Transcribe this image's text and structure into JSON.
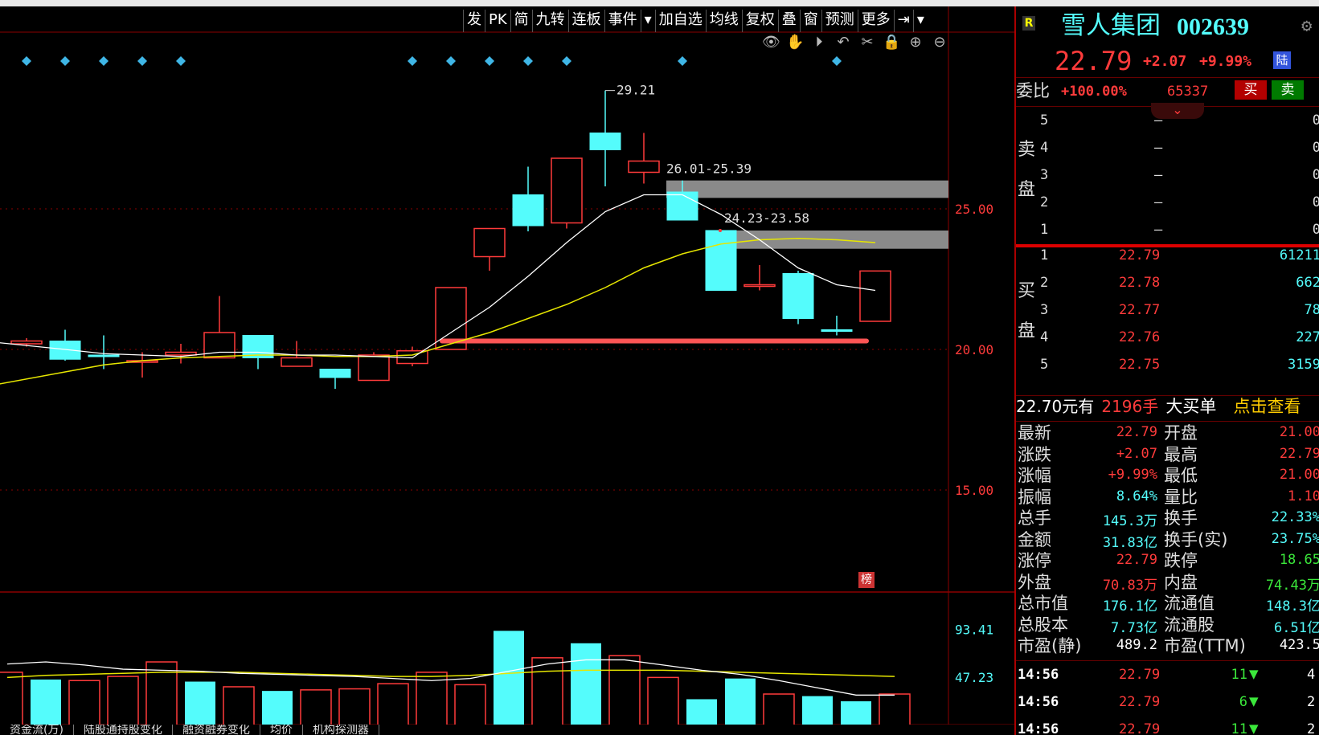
{
  "toolbar": {
    "items": [
      "发",
      "PK",
      "简",
      "九转",
      "连板",
      "事件",
      "▾",
      "加自选",
      "均线",
      "复权",
      "叠",
      "窗",
      "预测",
      "更多",
      "⇥",
      "▾"
    ],
    "tools": [
      "👁",
      "✋",
      "⏵",
      "↶",
      "✂",
      "🔒",
      "⊕",
      "⊖"
    ]
  },
  "chart_data": {
    "type": "candlestick",
    "price_axis": {
      "ticks": [
        "25.00",
        "20.00",
        "15.00"
      ],
      "tick_values": [
        25,
        20,
        15
      ],
      "ylim": [
        10.25,
        29.25
      ]
    },
    "volume_axis": {
      "ticks": [
        "93.41",
        "47.23"
      ],
      "tick_values": [
        93.41,
        47.23
      ],
      "ylim": [
        0,
        100
      ]
    },
    "candles": [
      {
        "o": 20.2,
        "h": 20.4,
        "l": 20.1,
        "c": 20.3,
        "up": true
      },
      {
        "o": 20.3,
        "h": 20.7,
        "l": 19.6,
        "c": 19.65,
        "up": false
      },
      {
        "o": 19.8,
        "h": 20.5,
        "l": 19.3,
        "c": 19.8,
        "up": false
      },
      {
        "o": 19.6,
        "h": 19.9,
        "l": 19.0,
        "c": 19.6,
        "up": true
      },
      {
        "o": 19.9,
        "h": 20.2,
        "l": 19.5,
        "c": 19.8,
        "up": true
      },
      {
        "o": 19.7,
        "h": 21.9,
        "l": 19.7,
        "c": 20.6,
        "up": true
      },
      {
        "o": 20.5,
        "h": 20.5,
        "l": 19.3,
        "c": 19.7,
        "up": false
      },
      {
        "o": 19.4,
        "h": 20.3,
        "l": 19.4,
        "c": 19.7,
        "up": true
      },
      {
        "o": 19.3,
        "h": 19.3,
        "l": 18.6,
        "c": 19.0,
        "up": false
      },
      {
        "o": 18.9,
        "h": 19.9,
        "l": 18.9,
        "c": 19.8,
        "up": true
      },
      {
        "o": 19.5,
        "h": 20.1,
        "l": 19.4,
        "c": 19.95,
        "up": true
      },
      {
        "o": 20.0,
        "h": 22.2,
        "l": 20.0,
        "c": 22.2,
        "up": true
      },
      {
        "o": 23.3,
        "h": 24.3,
        "l": 22.8,
        "c": 24.3,
        "up": true
      },
      {
        "o": 25.5,
        "h": 26.5,
        "l": 24.2,
        "c": 24.4,
        "up": false
      },
      {
        "o": 24.5,
        "h": 26.8,
        "l": 24.3,
        "c": 26.8,
        "up": true
      },
      {
        "o": 27.7,
        "h": 29.21,
        "l": 25.8,
        "c": 27.1,
        "up": false
      },
      {
        "o": 26.3,
        "h": 27.7,
        "l": 25.9,
        "c": 26.7,
        "up": true
      },
      {
        "o": 25.6,
        "h": 26.01,
        "l": 24.6,
        "c": 24.6,
        "up": false
      },
      {
        "o": 24.23,
        "h": 24.23,
        "l": 22.1,
        "c": 22.1,
        "up": false
      },
      {
        "o": 22.3,
        "h": 23.0,
        "l": 22.1,
        "c": 22.3,
        "up": true
      },
      {
        "o": 22.7,
        "h": 22.8,
        "l": 20.9,
        "c": 21.1,
        "up": false
      },
      {
        "o": 20.7,
        "h": 21.2,
        "l": 20.5,
        "c": 20.7,
        "up": false
      },
      {
        "o": 21.0,
        "h": 22.79,
        "l": 21.0,
        "c": 22.79,
        "up": true
      }
    ],
    "ma_white": [
      20.25,
      20.0,
      19.85,
      19.8,
      19.75,
      19.9,
      19.9,
      19.8,
      19.8,
      19.75,
      19.7,
      20.6,
      21.5,
      22.6,
      23.8,
      24.9,
      25.5,
      25.5,
      24.8,
      23.9,
      22.9,
      22.3,
      22.1
    ],
    "ma_yellow": [
      18.75,
      19.2,
      19.45,
      19.6,
      19.7,
      19.75,
      19.8,
      19.8,
      19.75,
      19.75,
      19.8,
      20.2,
      20.6,
      21.1,
      21.6,
      22.2,
      22.9,
      23.4,
      23.75,
      23.9,
      23.95,
      23.9,
      23.8
    ],
    "volumes": [
      [
        52,
        true
      ],
      [
        45,
        false
      ],
      [
        44,
        true
      ],
      [
        48,
        true
      ],
      [
        62,
        true
      ],
      [
        43,
        false
      ],
      [
        38,
        true
      ],
      [
        34,
        false
      ],
      [
        35,
        true
      ],
      [
        36,
        true
      ],
      [
        41,
        true
      ],
      [
        52,
        true
      ],
      [
        40,
        true
      ],
      [
        92,
        false
      ],
      [
        66,
        true
      ],
      [
        80,
        false
      ],
      [
        68,
        true
      ],
      [
        47,
        true
      ],
      [
        26,
        false
      ],
      [
        46,
        false
      ],
      [
        31,
        true
      ],
      [
        29,
        false
      ],
      [
        24,
        false
      ],
      [
        31,
        true
      ]
    ],
    "vol_ma_white": [
      60,
      62,
      59,
      55,
      54,
      53,
      51,
      50,
      49,
      48,
      46,
      44,
      46,
      53,
      60,
      64,
      64,
      59,
      54,
      50,
      44,
      37,
      30,
      30
    ],
    "vol_ma_yellow": [
      47,
      49,
      50,
      51,
      52,
      52,
      52,
      51,
      50,
      49,
      48,
      48,
      49,
      51,
      53,
      54,
      54,
      54,
      53,
      52,
      51,
      50,
      49,
      48
    ],
    "annotations": {
      "high_label": "29.21",
      "zone1_label": "26.01-25.39",
      "zone1": [
        26.01,
        25.39
      ],
      "zone2_label": "24.23-23.58",
      "zone2": [
        24.23,
        23.58
      ],
      "support_level": 20.3
    },
    "markers": [
      0,
      1,
      2,
      3,
      4,
      10,
      11,
      12,
      13,
      14,
      17,
      21
    ]
  },
  "rank_badge": "榜",
  "bottom_tabs": [
    "资金流(万)",
    "陆股通持股变化",
    "融资融券变化",
    "均价",
    "机构探测器"
  ],
  "stock": {
    "badge": "R",
    "name": "雪人集团",
    "code": "002639",
    "price": "22.79",
    "change": "+2.07",
    "change_pct": "+9.99%",
    "lu_badge": "陆"
  },
  "weibi": {
    "label": "委比",
    "value": "+100.00%",
    "count": "65337",
    "buy_btn": "买",
    "sell_btn": "卖"
  },
  "sell_side": {
    "label": "卖盘",
    "rows": [
      {
        "n": "5",
        "price": "—",
        "vol": "0"
      },
      {
        "n": "4",
        "price": "—",
        "vol": "0"
      },
      {
        "n": "3",
        "price": "—",
        "vol": "0"
      },
      {
        "n": "2",
        "price": "—",
        "vol": "0"
      },
      {
        "n": "1",
        "price": "—",
        "vol": "0"
      }
    ]
  },
  "buy_side": {
    "label": "买盘",
    "rows": [
      {
        "n": "1",
        "price": "22.79",
        "vol": "61211"
      },
      {
        "n": "2",
        "price": "22.78",
        "vol": "662"
      },
      {
        "n": "3",
        "price": "22.77",
        "vol": "78"
      },
      {
        "n": "4",
        "price": "22.76",
        "vol": "227"
      },
      {
        "n": "5",
        "price": "22.75",
        "vol": "3159"
      }
    ]
  },
  "big_order": {
    "price": "22.70元有",
    "qty": "2196手",
    "type": "大买单",
    "action": "点击查看"
  },
  "stats": [
    {
      "l1": "最新",
      "v1": "22.79",
      "c1": "red",
      "l2": "开盘",
      "v2": "21.00",
      "c2": "red"
    },
    {
      "l1": "涨跌",
      "v1": "+2.07",
      "c1": "red",
      "l2": "最高",
      "v2": "22.79",
      "c2": "red"
    },
    {
      "l1": "涨幅",
      "v1": "+9.99%",
      "c1": "red",
      "l2": "最低",
      "v2": "21.00",
      "c2": "red"
    },
    {
      "l1": "振幅",
      "v1": "8.64%",
      "c1": "cyan",
      "l2": "量比",
      "v2": "1.10",
      "c2": "red"
    },
    {
      "l1": "总手",
      "v1": "145.3万",
      "c1": "cyan",
      "l2": "换手",
      "v2": "22.33%",
      "c2": "cyan"
    },
    {
      "l1": "金额",
      "v1": "31.83亿",
      "c1": "cyan",
      "l2": "换手(实)",
      "v2": "23.75%",
      "c2": "cyan"
    },
    {
      "l1": "涨停",
      "v1": "22.79",
      "c1": "red",
      "l2": "跌停",
      "v2": "18.65",
      "c2": "green"
    },
    {
      "l1": "外盘",
      "v1": "70.83万",
      "c1": "red",
      "l2": "内盘",
      "v2": "74.43万",
      "c2": "green"
    },
    {
      "l1": "总市值",
      "v1": "176.1亿",
      "c1": "cyan",
      "l2": "流通值",
      "v2": "148.3亿",
      "c2": "cyan"
    },
    {
      "l1": "总股本",
      "v1": "7.73亿",
      "c1": "cyan",
      "l2": "流通股",
      "v2": "6.51亿",
      "c2": "cyan"
    },
    {
      "l1": "市盈(静)",
      "v1": "489.2",
      "c1": "white",
      "l2": "市盈(TTM)",
      "v2": "423.5",
      "c2": "white"
    }
  ],
  "ticks": [
    {
      "time": "14:56",
      "price": "22.79",
      "vol": "11",
      "extra": "4"
    },
    {
      "time": "14:56",
      "price": "22.79",
      "vol": "6",
      "extra": "2"
    },
    {
      "time": "14:56",
      "price": "22.79",
      "vol": "11",
      "extra": "2"
    }
  ],
  "colors": {
    "up": "#ff3b3b",
    "down": "#54fcfc",
    "ma_white": "#ffffff",
    "ma_yellow": "#e6e600",
    "support": "#ff5555",
    "zone": "#8a8a8a",
    "marker": "#3fb6e6",
    "grid": "#8b0000"
  }
}
